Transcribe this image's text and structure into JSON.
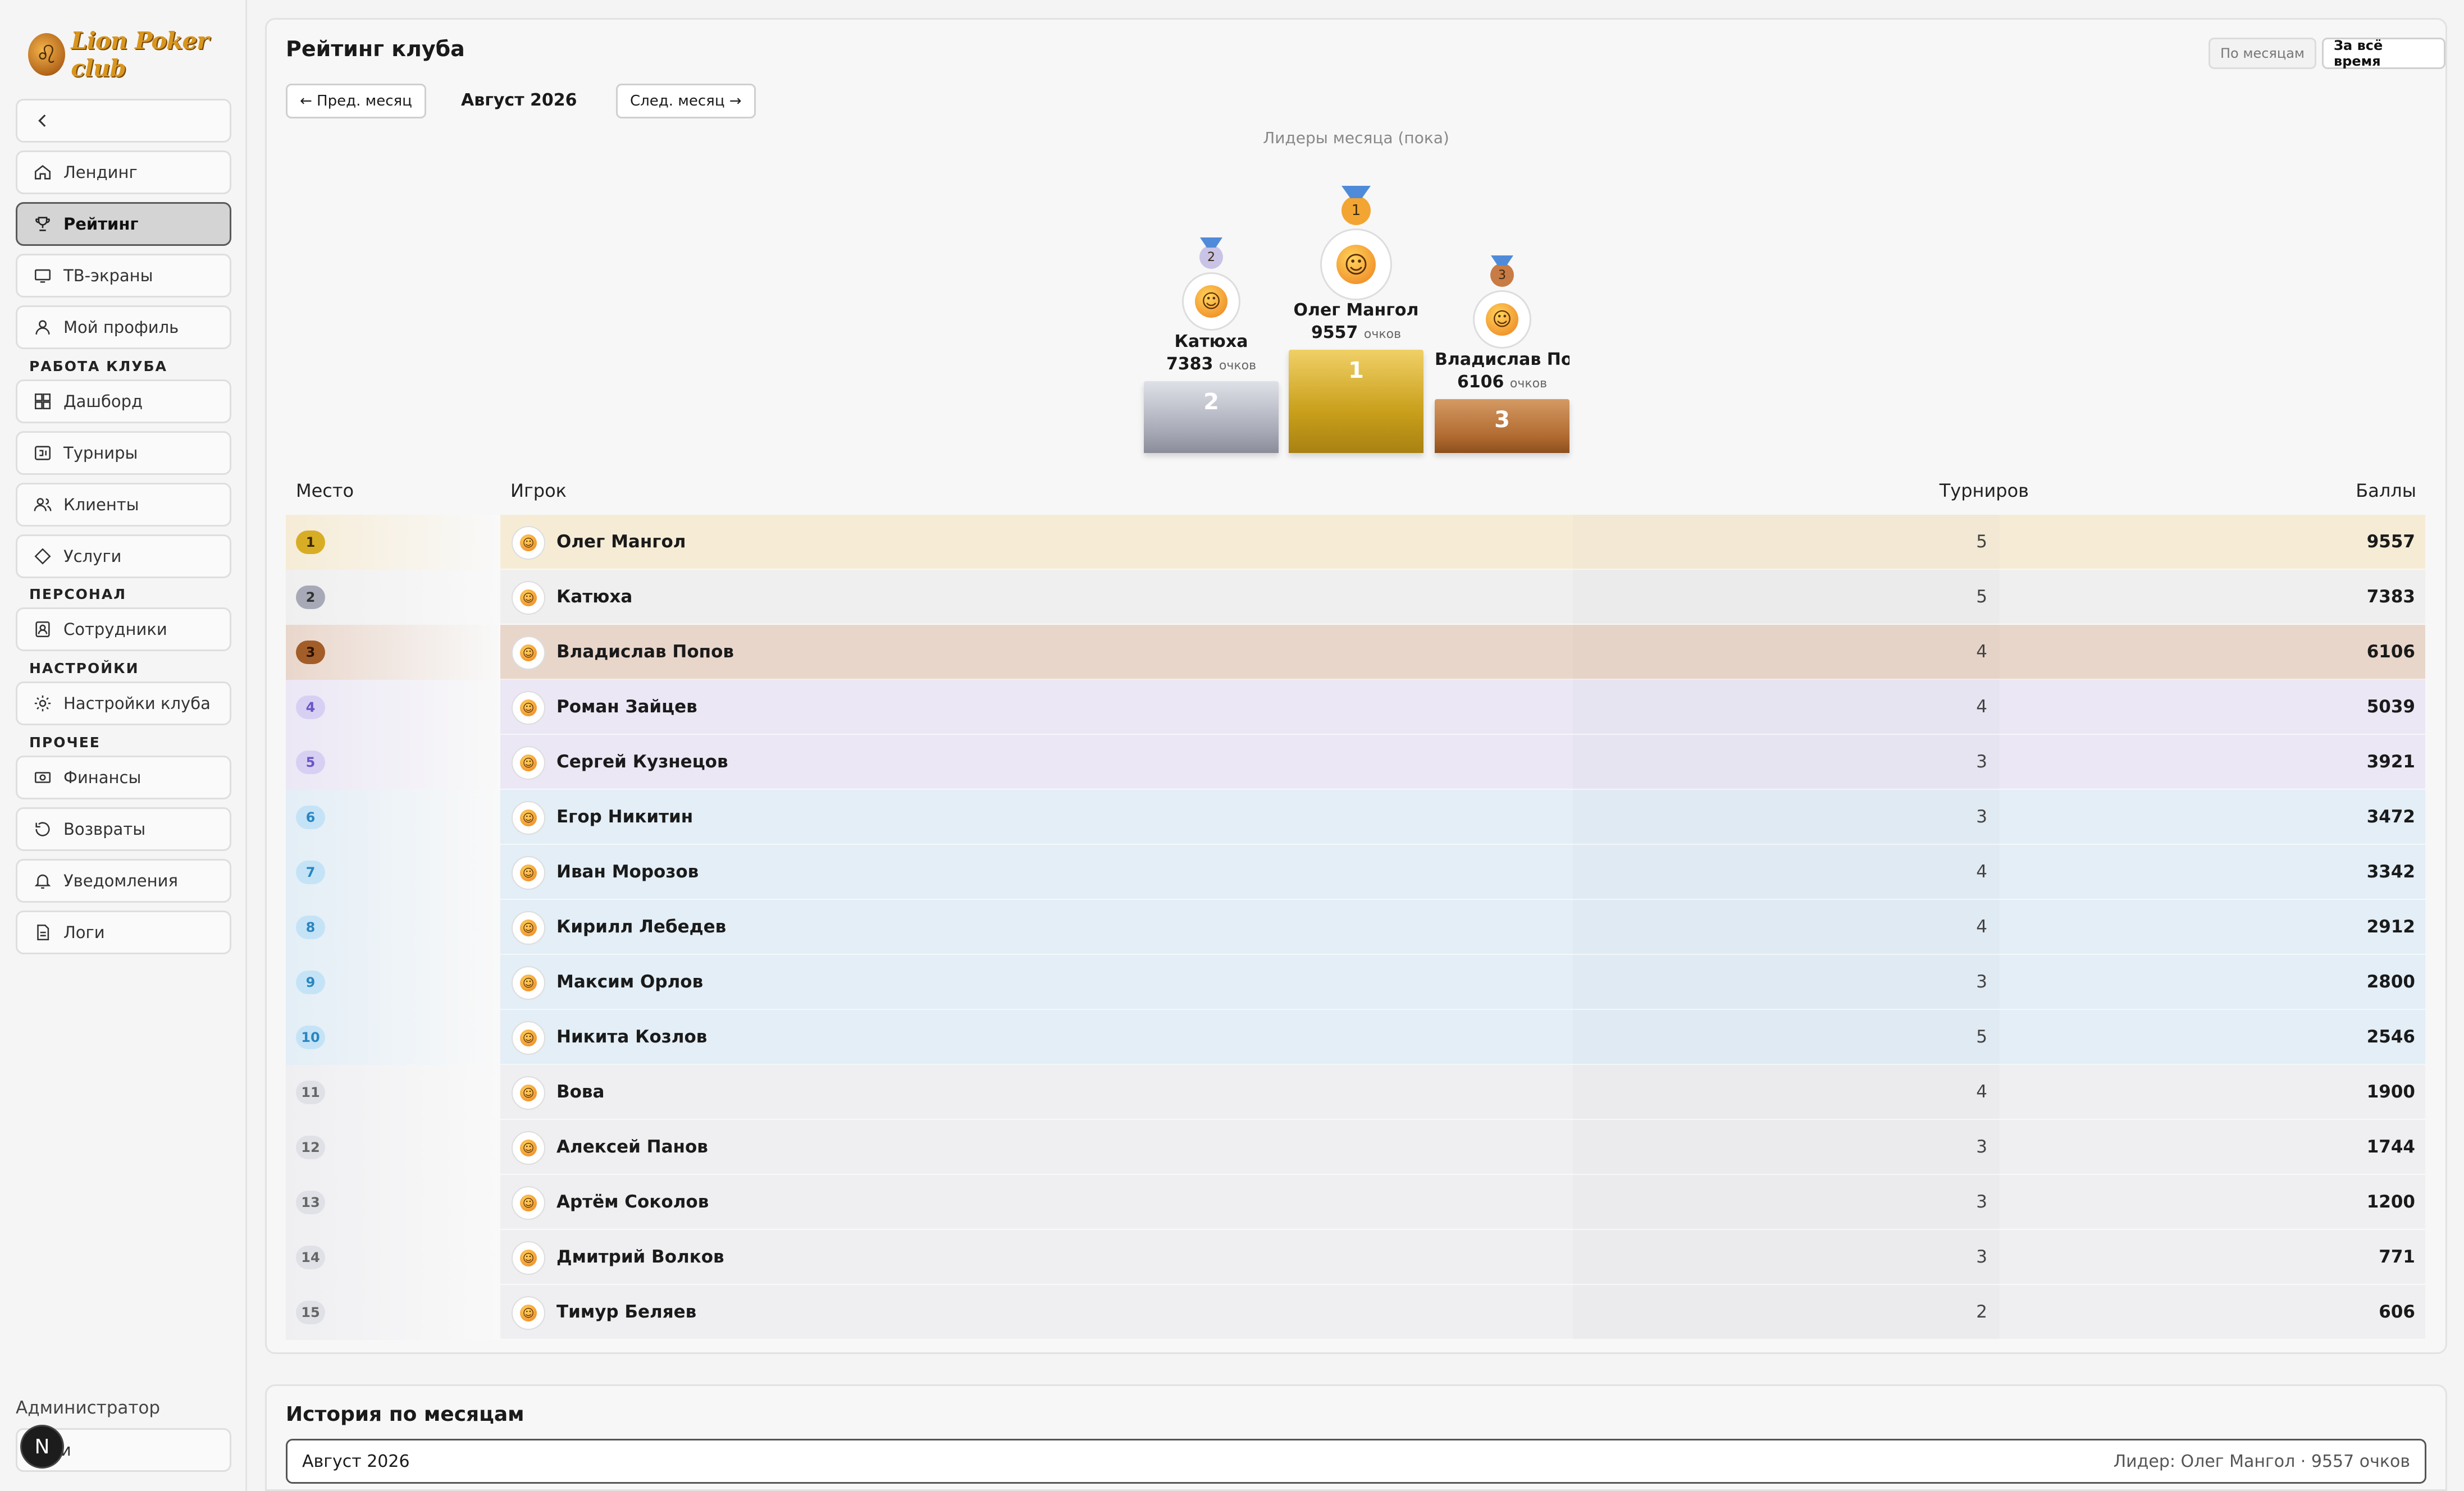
{
  "brand": {
    "logo_text": "Lion Poker club"
  },
  "sidebar": {
    "collapse_label": "",
    "items_top": [
      {
        "label": "Лендинг",
        "icon": "home-icon"
      },
      {
        "label": "Рейтинг",
        "icon": "trophy-icon",
        "active": true
      },
      {
        "label": "ТВ-экраны",
        "icon": "monitor-icon"
      },
      {
        "label": "Мой профиль",
        "icon": "user-icon"
      }
    ],
    "section_club": "РАБОТА КЛУБА",
    "items_club": [
      {
        "label": "Дашборд",
        "icon": "dashboard-icon"
      },
      {
        "label": "Турниры",
        "icon": "tournament-icon"
      },
      {
        "label": "Клиенты",
        "icon": "clients-icon"
      },
      {
        "label": "Услуги",
        "icon": "diamond-icon"
      }
    ],
    "section_staff": "ПЕРСОНАЛ",
    "items_staff": [
      {
        "label": "Сотрудники",
        "icon": "staff-icon"
      }
    ],
    "section_settings": "НАСТРОЙКИ",
    "items_settings": [
      {
        "label": "Настройки клуба",
        "icon": "settings-icon"
      }
    ],
    "section_other": "ПРОЧЕЕ",
    "items_other": [
      {
        "label": "Финансы",
        "icon": "finance-icon"
      },
      {
        "label": "Возвраты",
        "icon": "refund-icon"
      },
      {
        "label": "Уведомления",
        "icon": "bell-icon"
      },
      {
        "label": "Логи",
        "icon": "logs-icon"
      }
    ],
    "role": "Администратор",
    "logout_label": "ти",
    "avatar_letter": "N"
  },
  "rating": {
    "title": "Рейтинг клуба",
    "toggle_monthly": "По месяцам",
    "toggle_alltime": "За всё время",
    "prev_month": "← Пред. месяц",
    "next_month": "След. месяц →",
    "current_month": "Август 2026",
    "leaders_title": "Лидеры месяца (пока)",
    "points_unit": "очков",
    "podium": [
      {
        "place": "1",
        "name": "Олег Мангол",
        "score": "9557"
      },
      {
        "place": "2",
        "name": "Катюха",
        "score": "7383"
      },
      {
        "place": "3",
        "name": "Владислав По...",
        "score": "6106"
      }
    ],
    "columns": {
      "place": "Место",
      "player": "Игрок",
      "tournaments": "Турниров",
      "points": "Баллы"
    },
    "rows": [
      {
        "place": "1",
        "name": "Олег Мангол",
        "tournaments": "5",
        "points": "9557"
      },
      {
        "place": "2",
        "name": "Катюха",
        "tournaments": "5",
        "points": "7383"
      },
      {
        "place": "3",
        "name": "Владислав Попов",
        "tournaments": "4",
        "points": "6106"
      },
      {
        "place": "4",
        "name": "Роман Зайцев",
        "tournaments": "4",
        "points": "5039"
      },
      {
        "place": "5",
        "name": "Сергей Кузнецов",
        "tournaments": "3",
        "points": "3921"
      },
      {
        "place": "6",
        "name": "Егор Никитин",
        "tournaments": "3",
        "points": "3472"
      },
      {
        "place": "7",
        "name": "Иван Морозов",
        "tournaments": "4",
        "points": "3342"
      },
      {
        "place": "8",
        "name": "Кирилл Лебедев",
        "tournaments": "4",
        "points": "2912"
      },
      {
        "place": "9",
        "name": "Максим Орлов",
        "tournaments": "3",
        "points": "2800"
      },
      {
        "place": "10",
        "name": "Никита Козлов",
        "tournaments": "5",
        "points": "2546"
      },
      {
        "place": "11",
        "name": "Вова",
        "tournaments": "4",
        "points": "1900"
      },
      {
        "place": "12",
        "name": "Алексей Панов",
        "tournaments": "3",
        "points": "1744"
      },
      {
        "place": "13",
        "name": "Артём Соколов",
        "tournaments": "3",
        "points": "1200"
      },
      {
        "place": "14",
        "name": "Дмитрий Волков",
        "tournaments": "3",
        "points": "771"
      },
      {
        "place": "15",
        "name": "Тимур Беляев",
        "tournaments": "2",
        "points": "606"
      }
    ]
  },
  "history": {
    "title": "История по месяцам",
    "entries": [
      {
        "month": "Август 2026",
        "leader": "Лидер: Олег Мангол · 9557 очков"
      }
    ]
  },
  "colors": {
    "gold": "#d8ad26",
    "silver": "#a7aab6",
    "bronze": "#a35d28",
    "row_gold": "#f6ecd6",
    "row_silver": "#efefef",
    "row_bronze": "#e9d6cb",
    "row_purple": "#ebe7f5",
    "row_blue": "#e3eef6",
    "row_gray": "#efeff2"
  }
}
